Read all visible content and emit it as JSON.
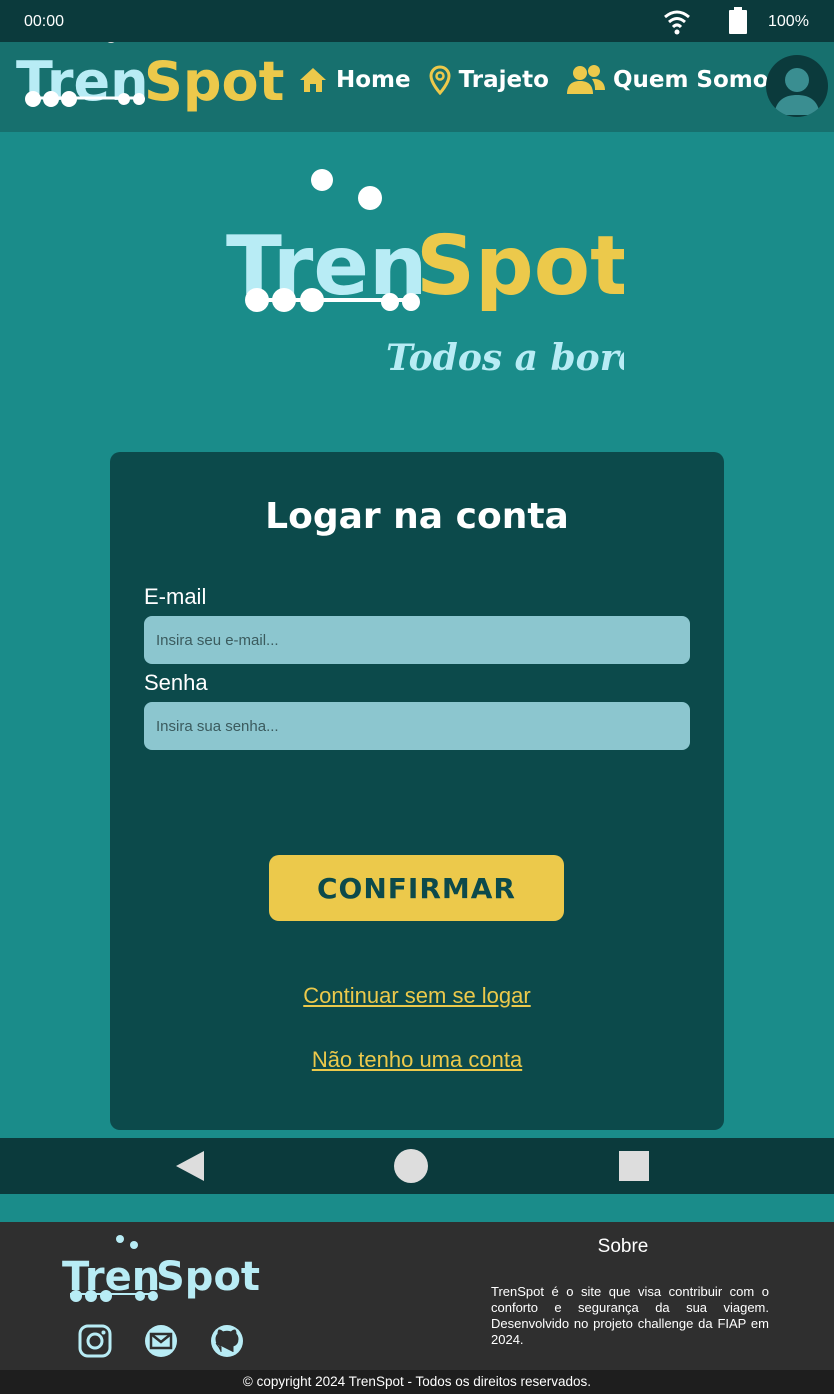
{
  "status_bar": {
    "time": "00:00",
    "battery": "100%"
  },
  "brand": {
    "name_part1": "Tren",
    "name_part2": "Spot",
    "slogan": "Todos a bordo!"
  },
  "header": {
    "nav": [
      {
        "label": "Home",
        "icon": "home-icon"
      },
      {
        "label": "Trajeto",
        "icon": "map-pin-icon"
      },
      {
        "label": "Quem Somos",
        "icon": "people-icon"
      }
    ],
    "avatar_icon": "user-avatar-icon"
  },
  "login": {
    "title": "Logar na conta",
    "email_label": "E-mail",
    "email_placeholder": "Insira seu e-mail...",
    "email_value": "",
    "password_label": "Senha",
    "password_placeholder": "Insira sua senha...",
    "password_value": "",
    "confirm_label": "CONFIRMAR",
    "continue_link": "Continuar sem se logar",
    "no_account_link": "Não tenho uma conta"
  },
  "footer": {
    "sobre_title": "Sobre",
    "sobre_text": "TrenSpot é o site que visa contribuir com o conforto e segurança da sua viagem. Desenvolvido no projeto challenge da FIAP em 2024.",
    "socials": [
      "instagram-icon",
      "mail-icon",
      "github-icon"
    ],
    "copyright": "© copyright 2024 TrenSpot - Todos os direitos reservados."
  },
  "colors": {
    "background": "#1a8c8a",
    "header": "#17706e",
    "dark": "#0c4a4b",
    "accent_yellow": "#ecc94b",
    "light_blue": "#b8ecf5",
    "input_bg": "#8cc6cf",
    "footer": "#2f2f2f"
  }
}
